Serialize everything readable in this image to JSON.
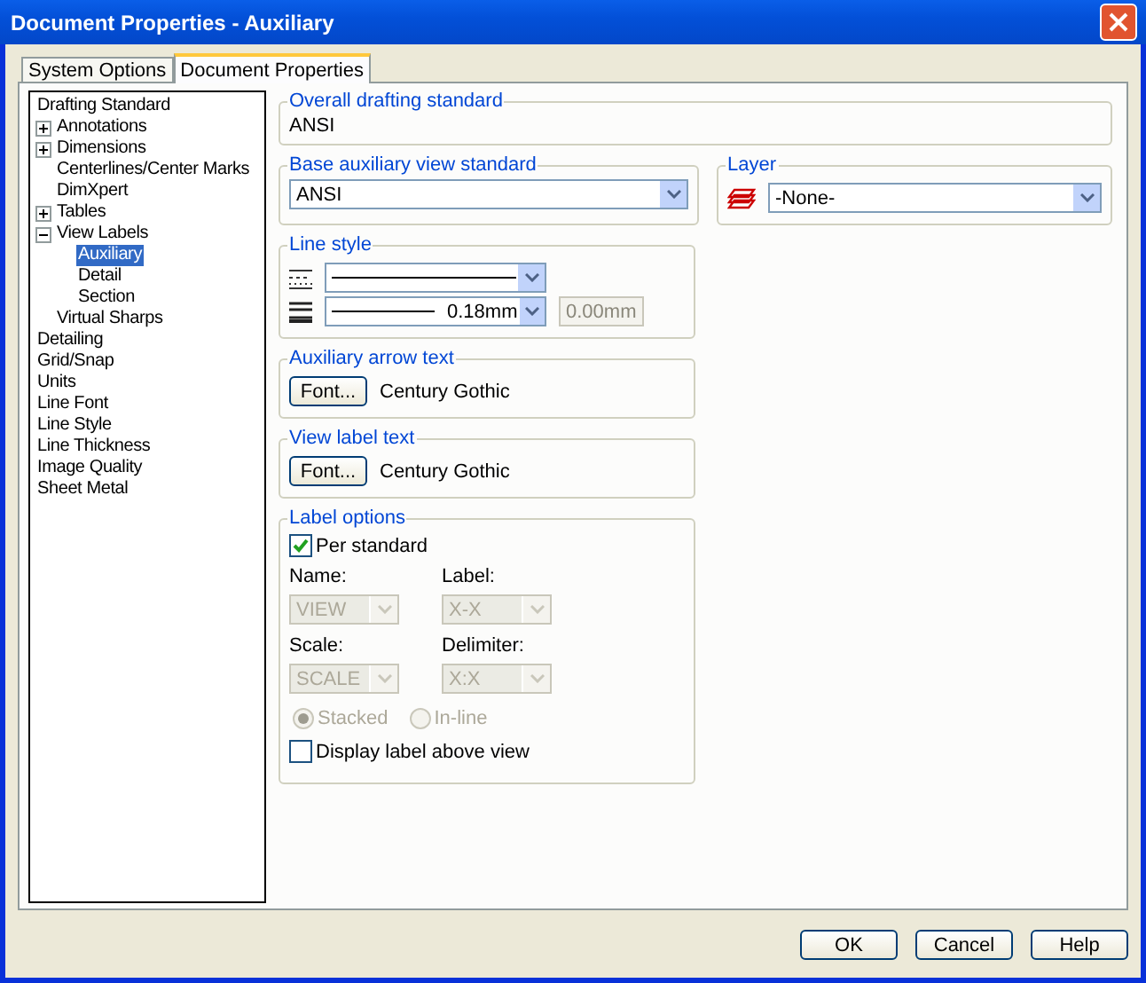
{
  "window": {
    "title": "Document Properties - Auxiliary"
  },
  "tabs": [
    {
      "label": "System Options",
      "selected": false
    },
    {
      "label": "Document Properties",
      "selected": true
    }
  ],
  "tree": [
    {
      "label": "Drafting Standard",
      "selected": false,
      "children": [
        {
          "label": "Annotations",
          "selected": false,
          "expanded": false
        },
        {
          "label": "Dimensions",
          "selected": false,
          "expanded": false
        },
        {
          "label": "Centerlines/Center Marks",
          "selected": false
        },
        {
          "label": "DimXpert",
          "selected": false
        },
        {
          "label": "Tables",
          "selected": false,
          "expanded": false
        },
        {
          "label": "View Labels",
          "selected": false,
          "expanded": true,
          "children": [
            {
              "label": "Auxiliary",
              "selected": true
            },
            {
              "label": "Detail",
              "selected": false
            },
            {
              "label": "Section",
              "selected": false
            }
          ]
        },
        {
          "label": "Virtual Sharps",
          "selected": false
        }
      ]
    },
    {
      "label": "Detailing",
      "selected": false
    },
    {
      "label": "Grid/Snap",
      "selected": false
    },
    {
      "label": "Units",
      "selected": false
    },
    {
      "label": "Line Font",
      "selected": false
    },
    {
      "label": "Line Style",
      "selected": false
    },
    {
      "label": "Line Thickness",
      "selected": false
    },
    {
      "label": "Image Quality",
      "selected": false
    },
    {
      "label": "Sheet Metal",
      "selected": false
    }
  ],
  "overall_standard": {
    "label": "Overall drafting standard",
    "value": "ANSI"
  },
  "base_view_standard": {
    "label": "Base auxiliary view standard",
    "value": "ANSI"
  },
  "layer": {
    "label": "Layer",
    "value": "-None-"
  },
  "line_style": {
    "label": "Line style",
    "thickness": "0.18mm",
    "custom_thickness": {
      "value": "0.00mm",
      "disabled": true
    }
  },
  "arrow_text": {
    "label": "Auxiliary arrow text",
    "button": "Font...",
    "font": "Century Gothic"
  },
  "view_label_text": {
    "label": "View label text",
    "button": "Font...",
    "font": "Century Gothic"
  },
  "label_options": {
    "label": "Label options",
    "per_standard": {
      "label": "Per standard",
      "checked": true
    },
    "fields": [
      {
        "label": "Name:",
        "value": "VIEW",
        "disabled": true
      },
      {
        "label": "Label:",
        "value": "X-X",
        "disabled": true
      },
      {
        "label": "Scale:",
        "value": "SCALE",
        "disabled": true
      },
      {
        "label": "Delimiter:",
        "value": "X:X",
        "disabled": true
      }
    ],
    "layout": [
      {
        "label": "Stacked",
        "selected": true,
        "disabled": true
      },
      {
        "label": "In-line",
        "selected": false,
        "disabled": true
      }
    ],
    "display_above": {
      "label": "Display label above view",
      "checked": false
    }
  },
  "buttons": [
    "OK",
    "Cancel",
    "Help"
  ]
}
